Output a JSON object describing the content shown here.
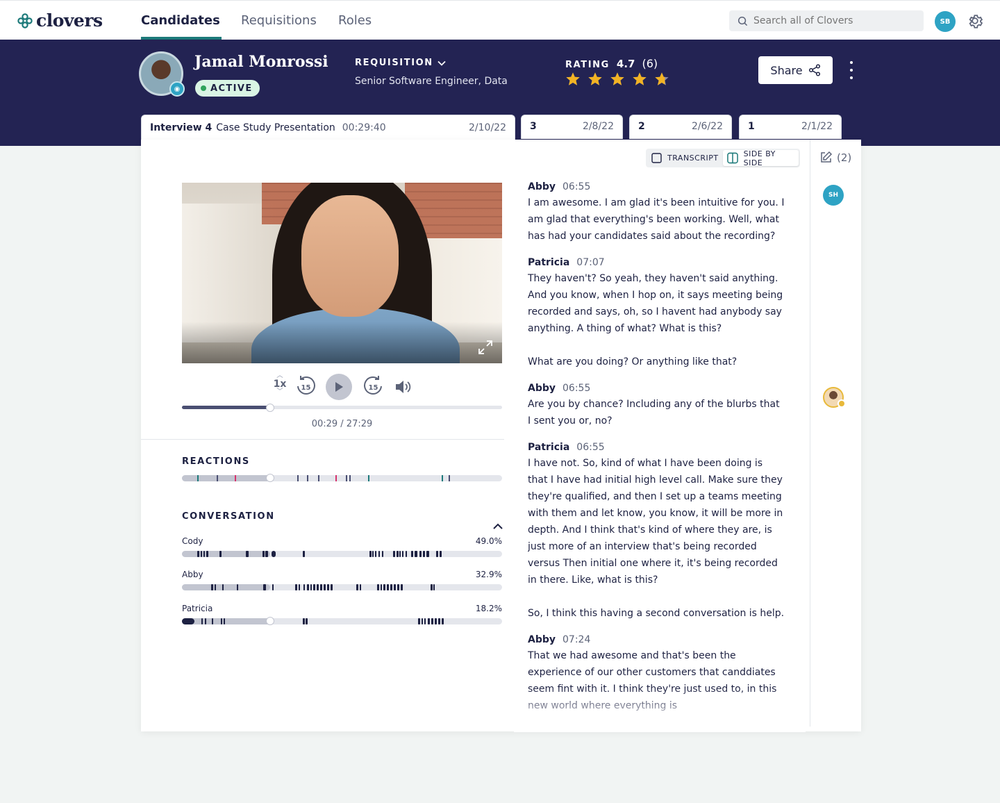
{
  "app": {
    "brand": "clovers",
    "accent": "#1d7a7a",
    "header_bg": "#232353"
  },
  "nav": {
    "tabs": [
      {
        "label": "Candidates"
      },
      {
        "label": "Requisitions"
      },
      {
        "label": "Roles"
      }
    ]
  },
  "search": {
    "placeholder": "Search all of Clovers"
  },
  "user": {
    "initials": "SB"
  },
  "candidate": {
    "name": "Jamal Monrossi",
    "status": "ACTIVE",
    "requisition_label": "REQUISITION",
    "requisition": "Senior Software Engineer, Data",
    "rating_label": "RATING",
    "rating": "4.7",
    "rating_count": "(6)",
    "stars_filled": 4.7
  },
  "actions": {
    "share": "Share"
  },
  "interviews": [
    {
      "number": "Interview 4",
      "title": "Case Study Presentation",
      "duration": "00:29:40",
      "date": "2/10/22"
    },
    {
      "number": "3",
      "date": "2/8/22"
    },
    {
      "number": "2",
      "date": "2/6/22"
    },
    {
      "number": "1",
      "date": "2/1/22"
    }
  ],
  "view_toggle": {
    "transcript": "TRANSCRIPT",
    "side_by_side": "SIDE BY SIDE"
  },
  "notes": {
    "count": "(2)"
  },
  "reviewers": {
    "sh": "SH"
  },
  "player": {
    "speed": "1x",
    "skip_back": "15",
    "skip_forward": "15",
    "time": "00:29 / 27:29",
    "progress": 0.275
  },
  "reactions": {
    "title": "REACTIONS"
  },
  "conversation": {
    "title": "CONVERSATION",
    "speakers": [
      {
        "name": "Cody",
        "pct": "49.0%"
      },
      {
        "name": "Abby",
        "pct": "32.9%"
      },
      {
        "name": "Patricia",
        "pct": "18.2%"
      }
    ]
  },
  "transcript": [
    {
      "speaker": "Abby",
      "time": "06:55",
      "paragraphs": [
        "I am awesome. I am glad it's been intuitive for you. I am glad that everything's been working. Well, what has had your candidates said about the recording?"
      ]
    },
    {
      "speaker": "Patricia",
      "time": "07:07",
      "paragraphs": [
        "They haven't? So yeah, they haven't said anything. And you know, when I hop on, it says meeting being recorded and says, oh, so I havent had anybody say anything. A thing of what? What is this?",
        "What are you doing? Or anything like that?"
      ]
    },
    {
      "speaker": "Abby",
      "time": "06:55",
      "paragraphs": [
        "Are you by chance? Including any of the blurbs that I sent you or, no?"
      ]
    },
    {
      "speaker": "Patricia",
      "time": "06:55",
      "paragraphs": [
        "I have not. So, kind of what I have been doing is that I have had initial high level call. Make sure they they're qualified, and then I set up a teams meeting with them and let know, you know, it will be more in depth. And I think that's kind of where they are, is just more of an interview that's being recorded versus Then initial one where it, it's being recorded in there. Like, what is this?",
        "So, I think this having a second conversation is help."
      ]
    },
    {
      "speaker": "Abby",
      "time": "07:24",
      "paragraphs": [
        "That we had awesome and that's been the experience of our other customers that canddiates seem fint with it. I think they're just used to, in this new world where everything is"
      ]
    }
  ]
}
